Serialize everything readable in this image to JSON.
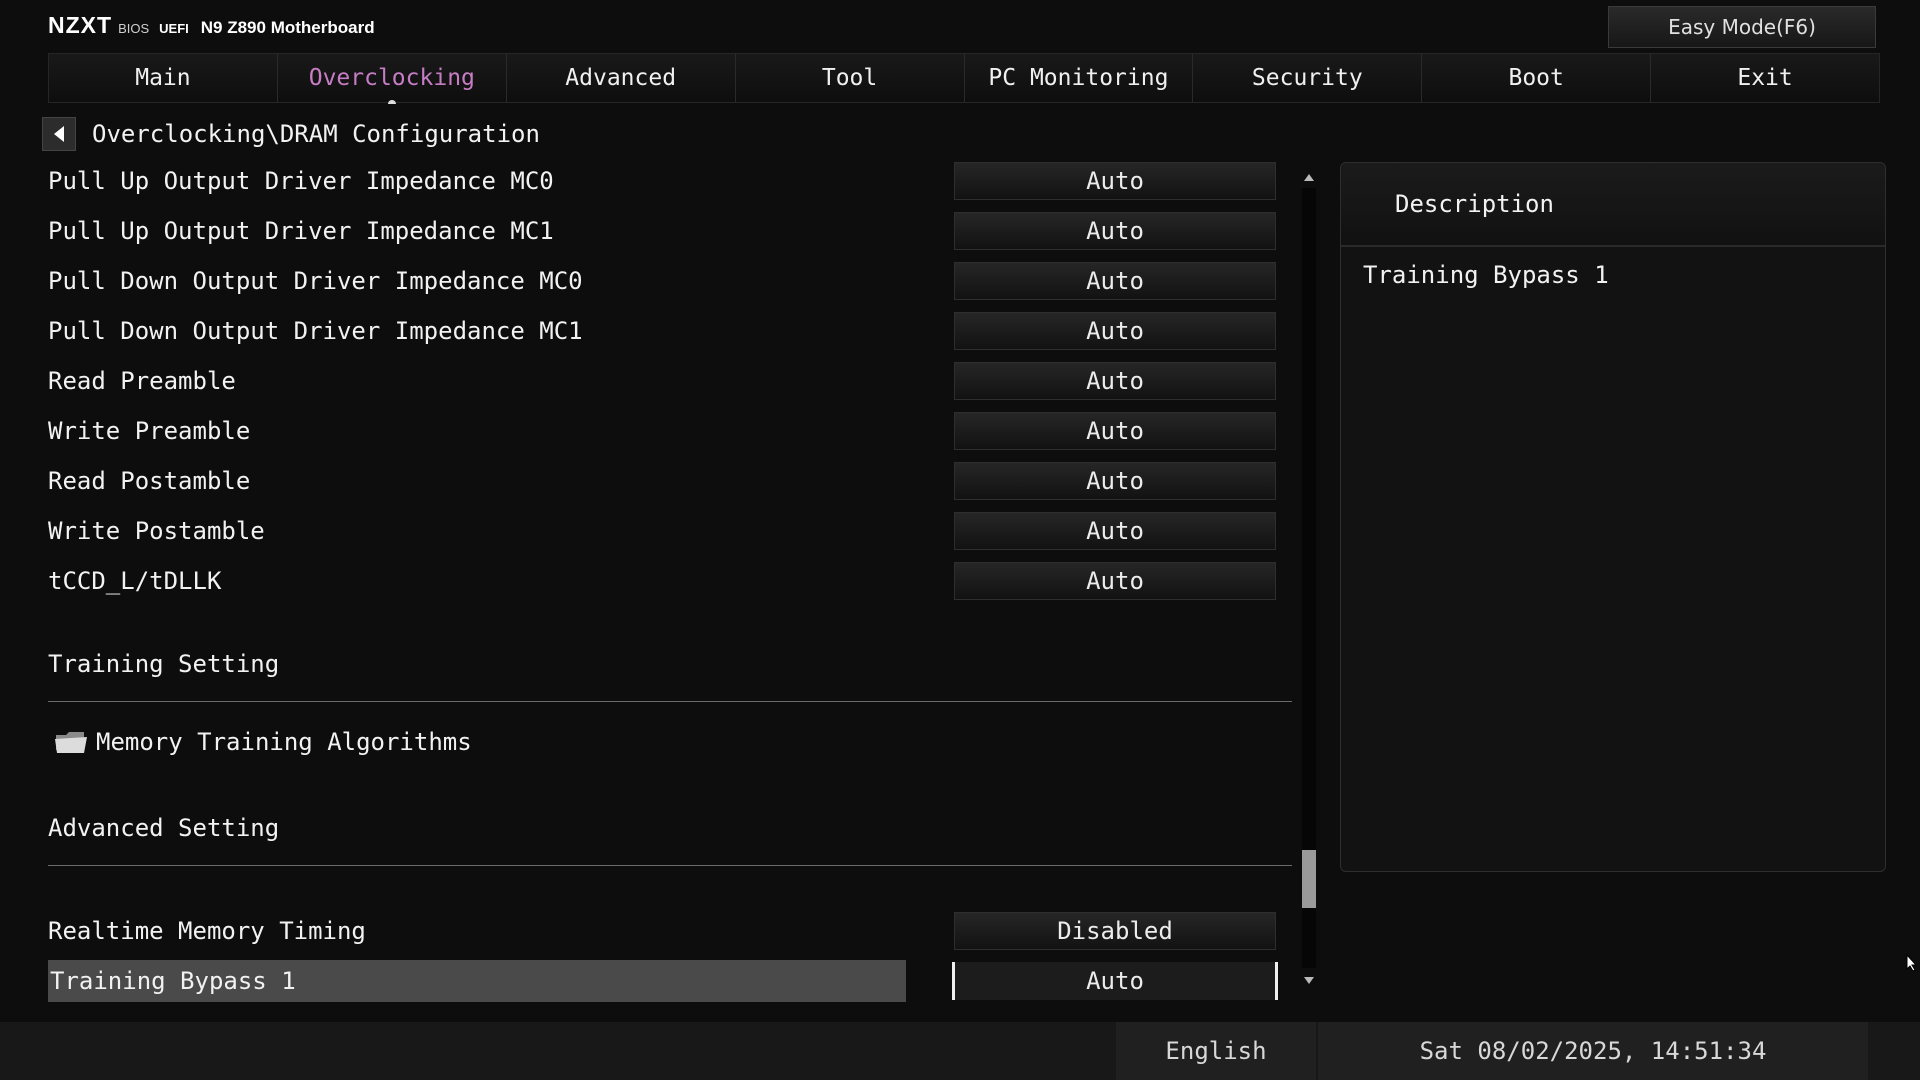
{
  "brand": {
    "logo": "NZXT",
    "bios": "BIOS",
    "uefi": "UEFI",
    "model": "N9 Z890 Motherboard"
  },
  "easy_mode_label": "Easy Mode(F6)",
  "tabs": [
    {
      "label": "Main"
    },
    {
      "label": "Overclocking",
      "active": true
    },
    {
      "label": "Advanced"
    },
    {
      "label": "Tool"
    },
    {
      "label": "PC Monitoring"
    },
    {
      "label": "Security"
    },
    {
      "label": "Boot"
    },
    {
      "label": "Exit"
    }
  ],
  "breadcrumb": "Overclocking\\DRAM Configuration",
  "settings": [
    {
      "label": "Pull Up Output Driver Impedance MC0",
      "value": "Auto"
    },
    {
      "label": "Pull Up Output Driver Impedance MC1",
      "value": "Auto"
    },
    {
      "label": "Pull Down Output Driver Impedance MC0",
      "value": "Auto"
    },
    {
      "label": "Pull Down Output Driver Impedance MC1",
      "value": "Auto"
    },
    {
      "label": "Read Preamble",
      "value": "Auto"
    },
    {
      "label": "Write Preamble",
      "value": "Auto"
    },
    {
      "label": "Read Postamble",
      "value": "Auto"
    },
    {
      "label": "Write Postamble",
      "value": "Auto"
    },
    {
      "label": "tCCD_L/tDLLK",
      "value": "Auto"
    }
  ],
  "training_section": {
    "title": "Training Setting",
    "submenu": "Memory Training Algorithms"
  },
  "advanced_section": {
    "title": "Advanced Setting",
    "items": [
      {
        "label": "Realtime Memory Timing",
        "value": "Disabled"
      },
      {
        "label": "Training Bypass 1",
        "value": "Auto",
        "selected": true
      }
    ]
  },
  "description": {
    "header": "Description",
    "text": "Training Bypass 1"
  },
  "status": {
    "language": "English",
    "datetime": "Sat 08/02/2025, 14:51:34"
  },
  "colors": {
    "active_tab": "#c77dc4",
    "background": "#0d0d0d",
    "selected_row": "#4a4a4a"
  },
  "scrollbar_position_fraction": 0.88
}
